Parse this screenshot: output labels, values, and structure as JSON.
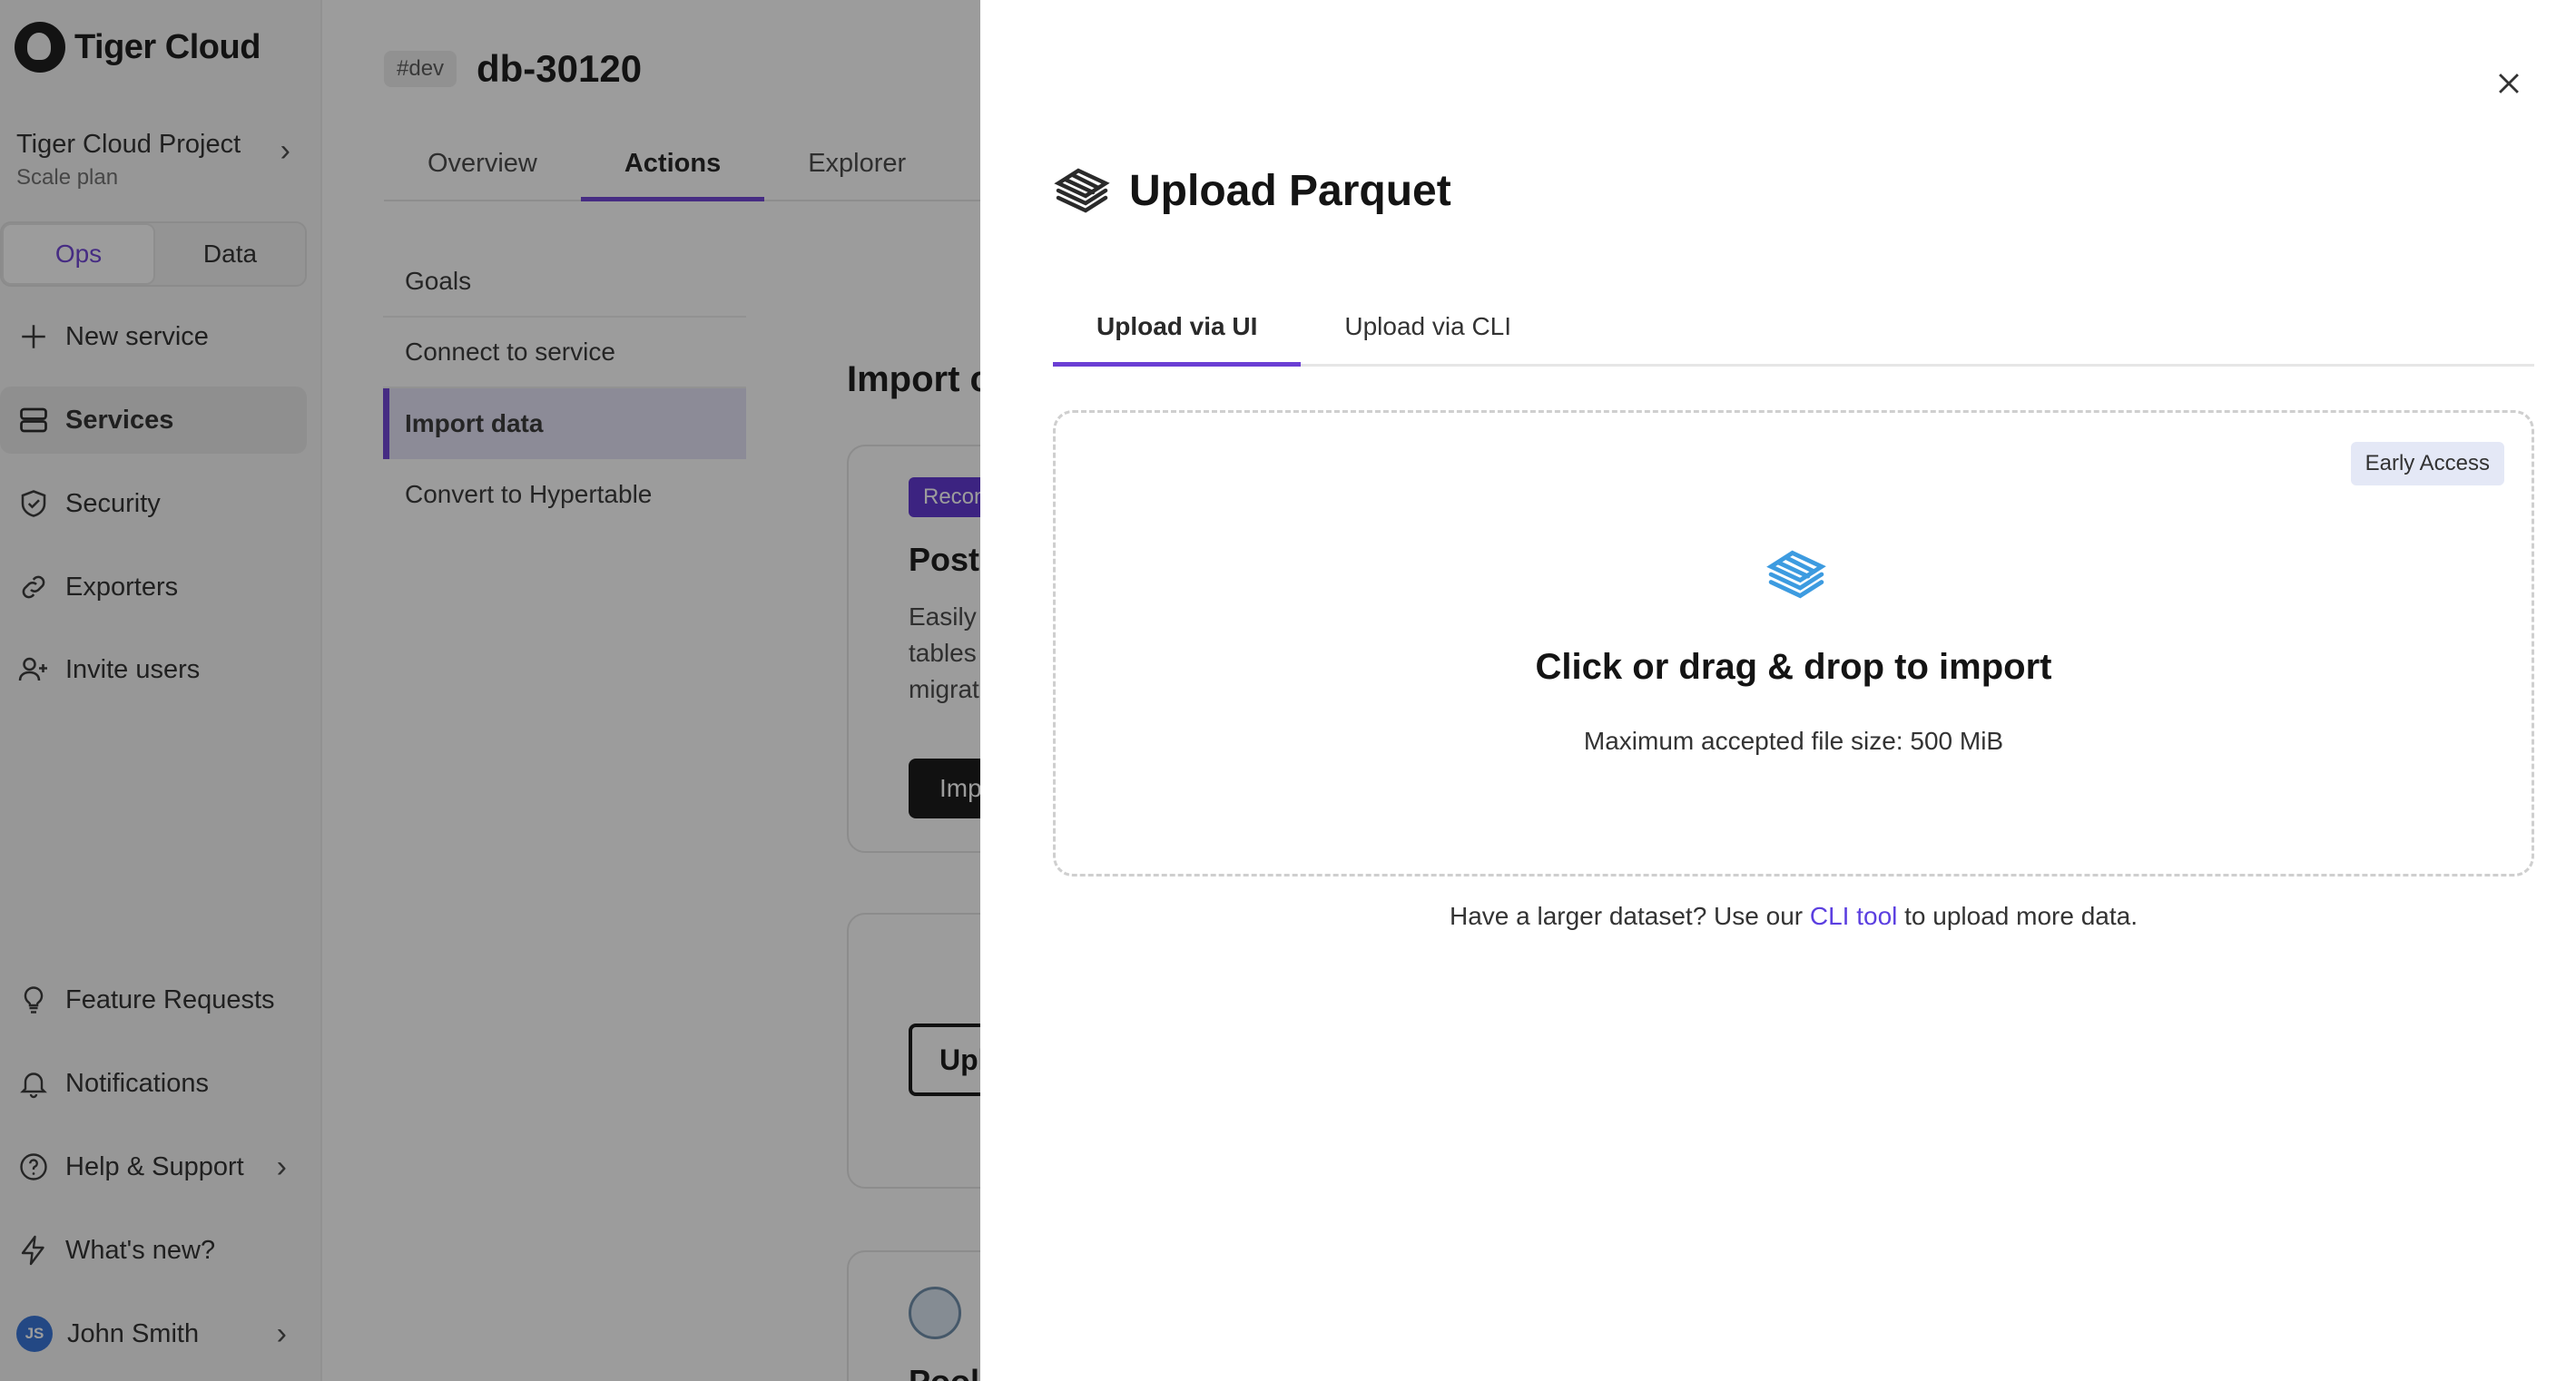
{
  "brand": {
    "name": "Tiger Cloud"
  },
  "project": {
    "name": "Tiger Cloud Project",
    "plan": "Scale plan"
  },
  "mode_toggle": {
    "ops": "Ops",
    "data": "Data"
  },
  "sidebar": {
    "items": [
      {
        "label": "New service",
        "icon": "plus-icon"
      },
      {
        "label": "Services",
        "icon": "servers-icon"
      },
      {
        "label": "Security",
        "icon": "shield-check-icon"
      },
      {
        "label": "Exporters",
        "icon": "link-icon"
      },
      {
        "label": "Invite users",
        "icon": "user-plus-icon"
      }
    ],
    "bottom_items": [
      {
        "label": "Feature Requests",
        "icon": "lightbulb-icon"
      },
      {
        "label": "Notifications",
        "icon": "bell-icon"
      },
      {
        "label": "Help & Support",
        "icon": "question-icon"
      },
      {
        "label": "What's new?",
        "icon": "bolt-icon"
      }
    ],
    "user": {
      "name": "John Smith",
      "initials": "JS"
    }
  },
  "service": {
    "env_tag": "#dev",
    "name": "db-30120"
  },
  "tabs": [
    "Overview",
    "Actions",
    "Explorer"
  ],
  "sub_nav": [
    "Goals",
    "Connect to service",
    "Import data",
    "Convert to Hypertable"
  ],
  "import_heading": "Import c",
  "card1": {
    "badge": "Recon",
    "title": "Postg",
    "desc_lines": [
      "Easily",
      "tables",
      "migrat"
    ],
    "button": "Imp"
  },
  "card2": {
    "button": "Upl"
  },
  "card3": {
    "title": "Pool"
  },
  "panel": {
    "title": "Upload Parquet",
    "tabs": [
      "Upload via UI",
      "Upload via CLI"
    ],
    "badge": "Early Access",
    "drop_title": "Click or drag & drop to import",
    "drop_sub": "Maximum accepted file size: 500 MiB",
    "cli_note_before": "Have a larger dataset? Use our ",
    "cli_link": "CLI tool",
    "cli_note_after": " to upload more data."
  },
  "colors": {
    "accent": "#6b3fd4",
    "link": "#5b3fe0",
    "parquet_icon": "#3d9be0"
  }
}
